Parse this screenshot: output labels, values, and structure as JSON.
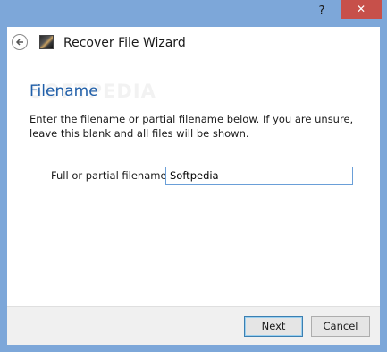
{
  "titlebar": {
    "help_label": "?",
    "close_label": "✕"
  },
  "header": {
    "title": "Recover File Wizard",
    "back_icon": "back-arrow-icon",
    "app_icon": "recover-file-app-icon"
  },
  "watermark": {
    "text": "SOFTPEDIA"
  },
  "page": {
    "title": "Filename",
    "description": "Enter the filename or partial filename below. If you are unsure, leave this blank and all files will be shown.",
    "field_label": "Full or partial filename:",
    "field_value": "Softpedia"
  },
  "footer": {
    "next_label": "Next",
    "cancel_label": "Cancel"
  },
  "colors": {
    "accent": "#1f5ea8",
    "close": "#c7504a",
    "frame": "#7da7d9"
  }
}
